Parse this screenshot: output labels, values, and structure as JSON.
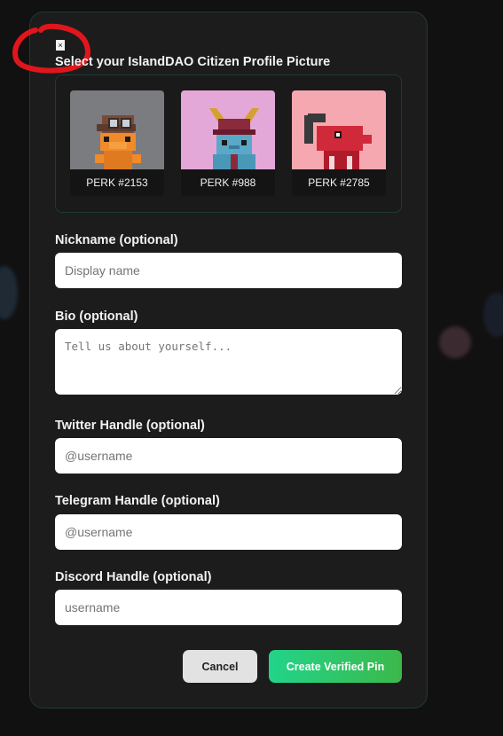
{
  "modal": {
    "close_glyph": "×",
    "title": "Select your IslandDAO Citizen Profile Picture"
  },
  "pfps": [
    {
      "label": "PERK #2153",
      "bg": "#7a7c80"
    },
    {
      "label": "PERK #988",
      "bg": "#e3a8d8"
    },
    {
      "label": "PERK #2785",
      "bg": "#f6a8b0"
    }
  ],
  "fields": {
    "nickname": {
      "label": "Nickname (optional)",
      "placeholder": "Display name"
    },
    "bio": {
      "label": "Bio (optional)",
      "placeholder": "Tell us about yourself..."
    },
    "twitter": {
      "label": "Twitter Handle (optional)",
      "placeholder": "@username"
    },
    "telegram": {
      "label": "Telegram Handle (optional)",
      "placeholder": "@username"
    },
    "discord": {
      "label": "Discord Handle (optional)",
      "placeholder": "username"
    }
  },
  "actions": {
    "cancel": "Cancel",
    "create": "Create Verified Pin"
  },
  "colors": {
    "accent_start": "#22d48a",
    "accent_end": "#3cb84a",
    "annotation_red": "#e0161c"
  }
}
